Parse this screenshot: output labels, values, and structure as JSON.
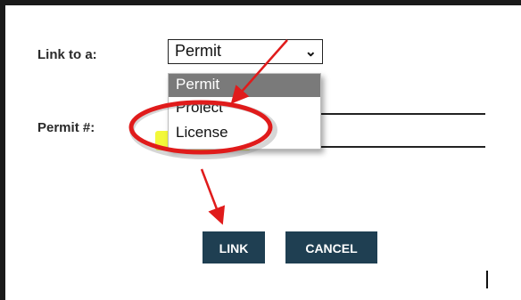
{
  "form": {
    "link_to_label": "Link to a:",
    "permit_number_label": "Permit #:",
    "select_value": "Permit",
    "options": [
      "Permit",
      "Project",
      "License"
    ]
  },
  "buttons": {
    "link_label": "LINK",
    "cancel_label": "CANCEL"
  },
  "colors": {
    "button_bg": "#1f3f52",
    "selected_option_bg": "#7a7a7a",
    "annotation_red": "#e01b1b",
    "highlight_yellow": "#f3f83a"
  }
}
